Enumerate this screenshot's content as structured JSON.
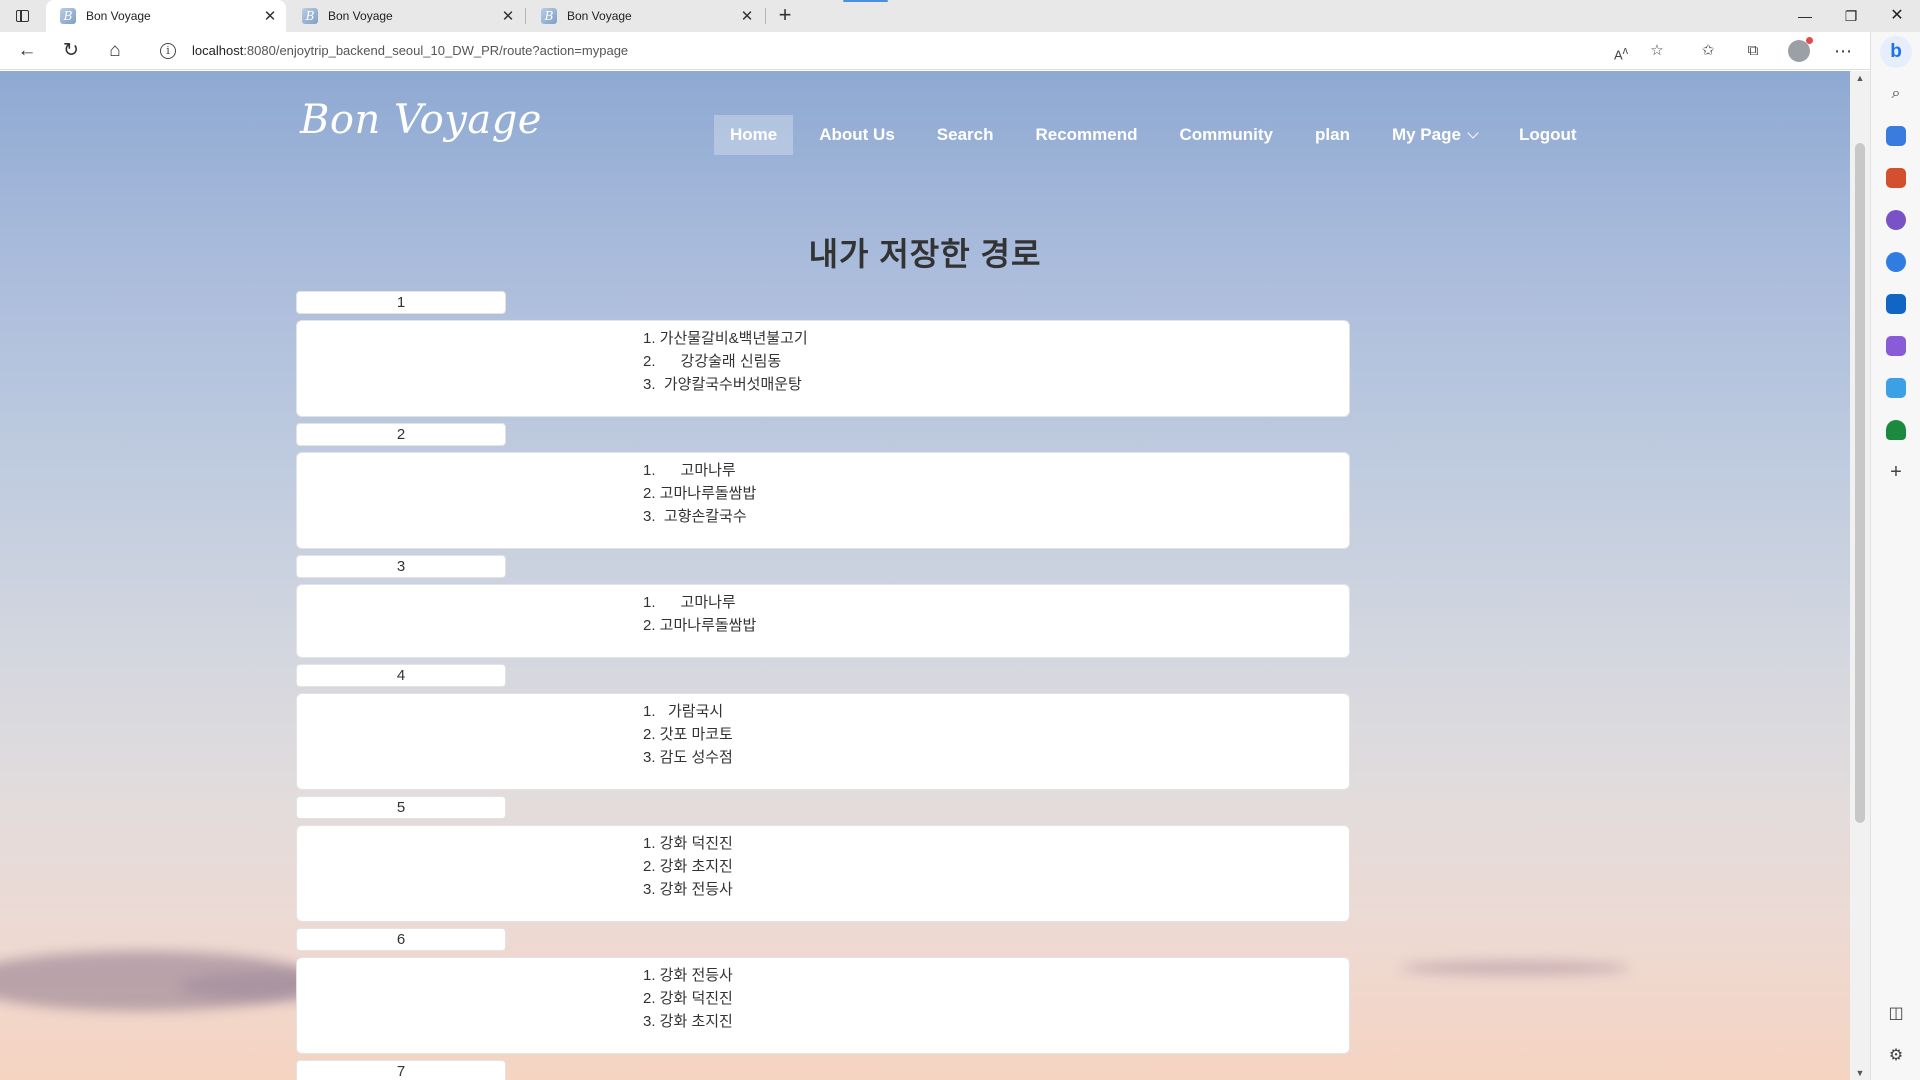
{
  "browser": {
    "tabs": [
      {
        "title": "Bon Voyage",
        "active": true
      },
      {
        "title": "Bon Voyage",
        "active": false
      },
      {
        "title": "Bon Voyage",
        "active": false
      }
    ],
    "url_host": "localhost",
    "url_rest": ":8080/enjoytrip_backend_seoul_10_DW_PR/route?action=mypage"
  },
  "site": {
    "logo": "Bon Voyage",
    "nav": [
      {
        "label": "Home",
        "active": true
      },
      {
        "label": "About Us"
      },
      {
        "label": "Search"
      },
      {
        "label": "Recommend"
      },
      {
        "label": "Community"
      },
      {
        "label": "plan"
      },
      {
        "label": "My Page",
        "dropdown": true
      },
      {
        "label": "Logout"
      }
    ]
  },
  "page": {
    "title": "내가 저장한 경로",
    "routes": [
      {
        "number": "1",
        "stops": [
          "1. 가산물갈비&백년불고기",
          "2.      강강술래 신림동",
          "3.  가양칼국수버섯매운탕"
        ]
      },
      {
        "number": "2",
        "stops": [
          "1.      고마나루",
          "2. 고마나루돌쌈밥",
          "3.  고향손칼국수"
        ]
      },
      {
        "number": "3",
        "stops": [
          "1.      고마나루",
          "2. 고마나루돌쌈밥"
        ]
      },
      {
        "number": "4",
        "stops": [
          "1.   가람국시",
          "2. 갓포 마코토",
          "3. 감도 성수점"
        ]
      },
      {
        "number": "5",
        "stops": [
          "1. 강화 덕진진",
          "2. 강화 초지진",
          "3. 강화 전등사"
        ]
      },
      {
        "number": "6",
        "stops": [
          "1. 강화 전등사",
          "2. 강화 덕진진",
          "3. 강화 초지진"
        ]
      },
      {
        "number": "7",
        "stops": []
      }
    ]
  },
  "colors": {
    "sky_top": "#8ea9d2",
    "sky_bottom": "#f5d4c2",
    "text": "#333333"
  }
}
